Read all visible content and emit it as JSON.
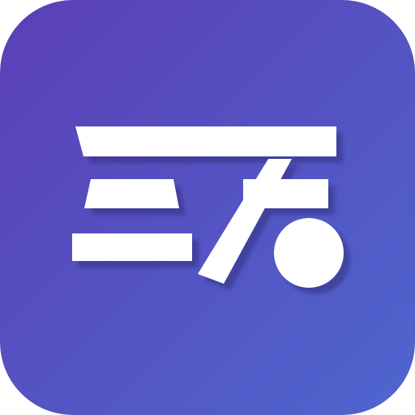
{
  "icon": {
    "name": "app-logo-icon",
    "colors": {
      "gradient_start": "#5b3fb6",
      "gradient_end": "#4e66cf",
      "glyph": "#ffffff",
      "shadow": "#2c2a6f"
    }
  }
}
